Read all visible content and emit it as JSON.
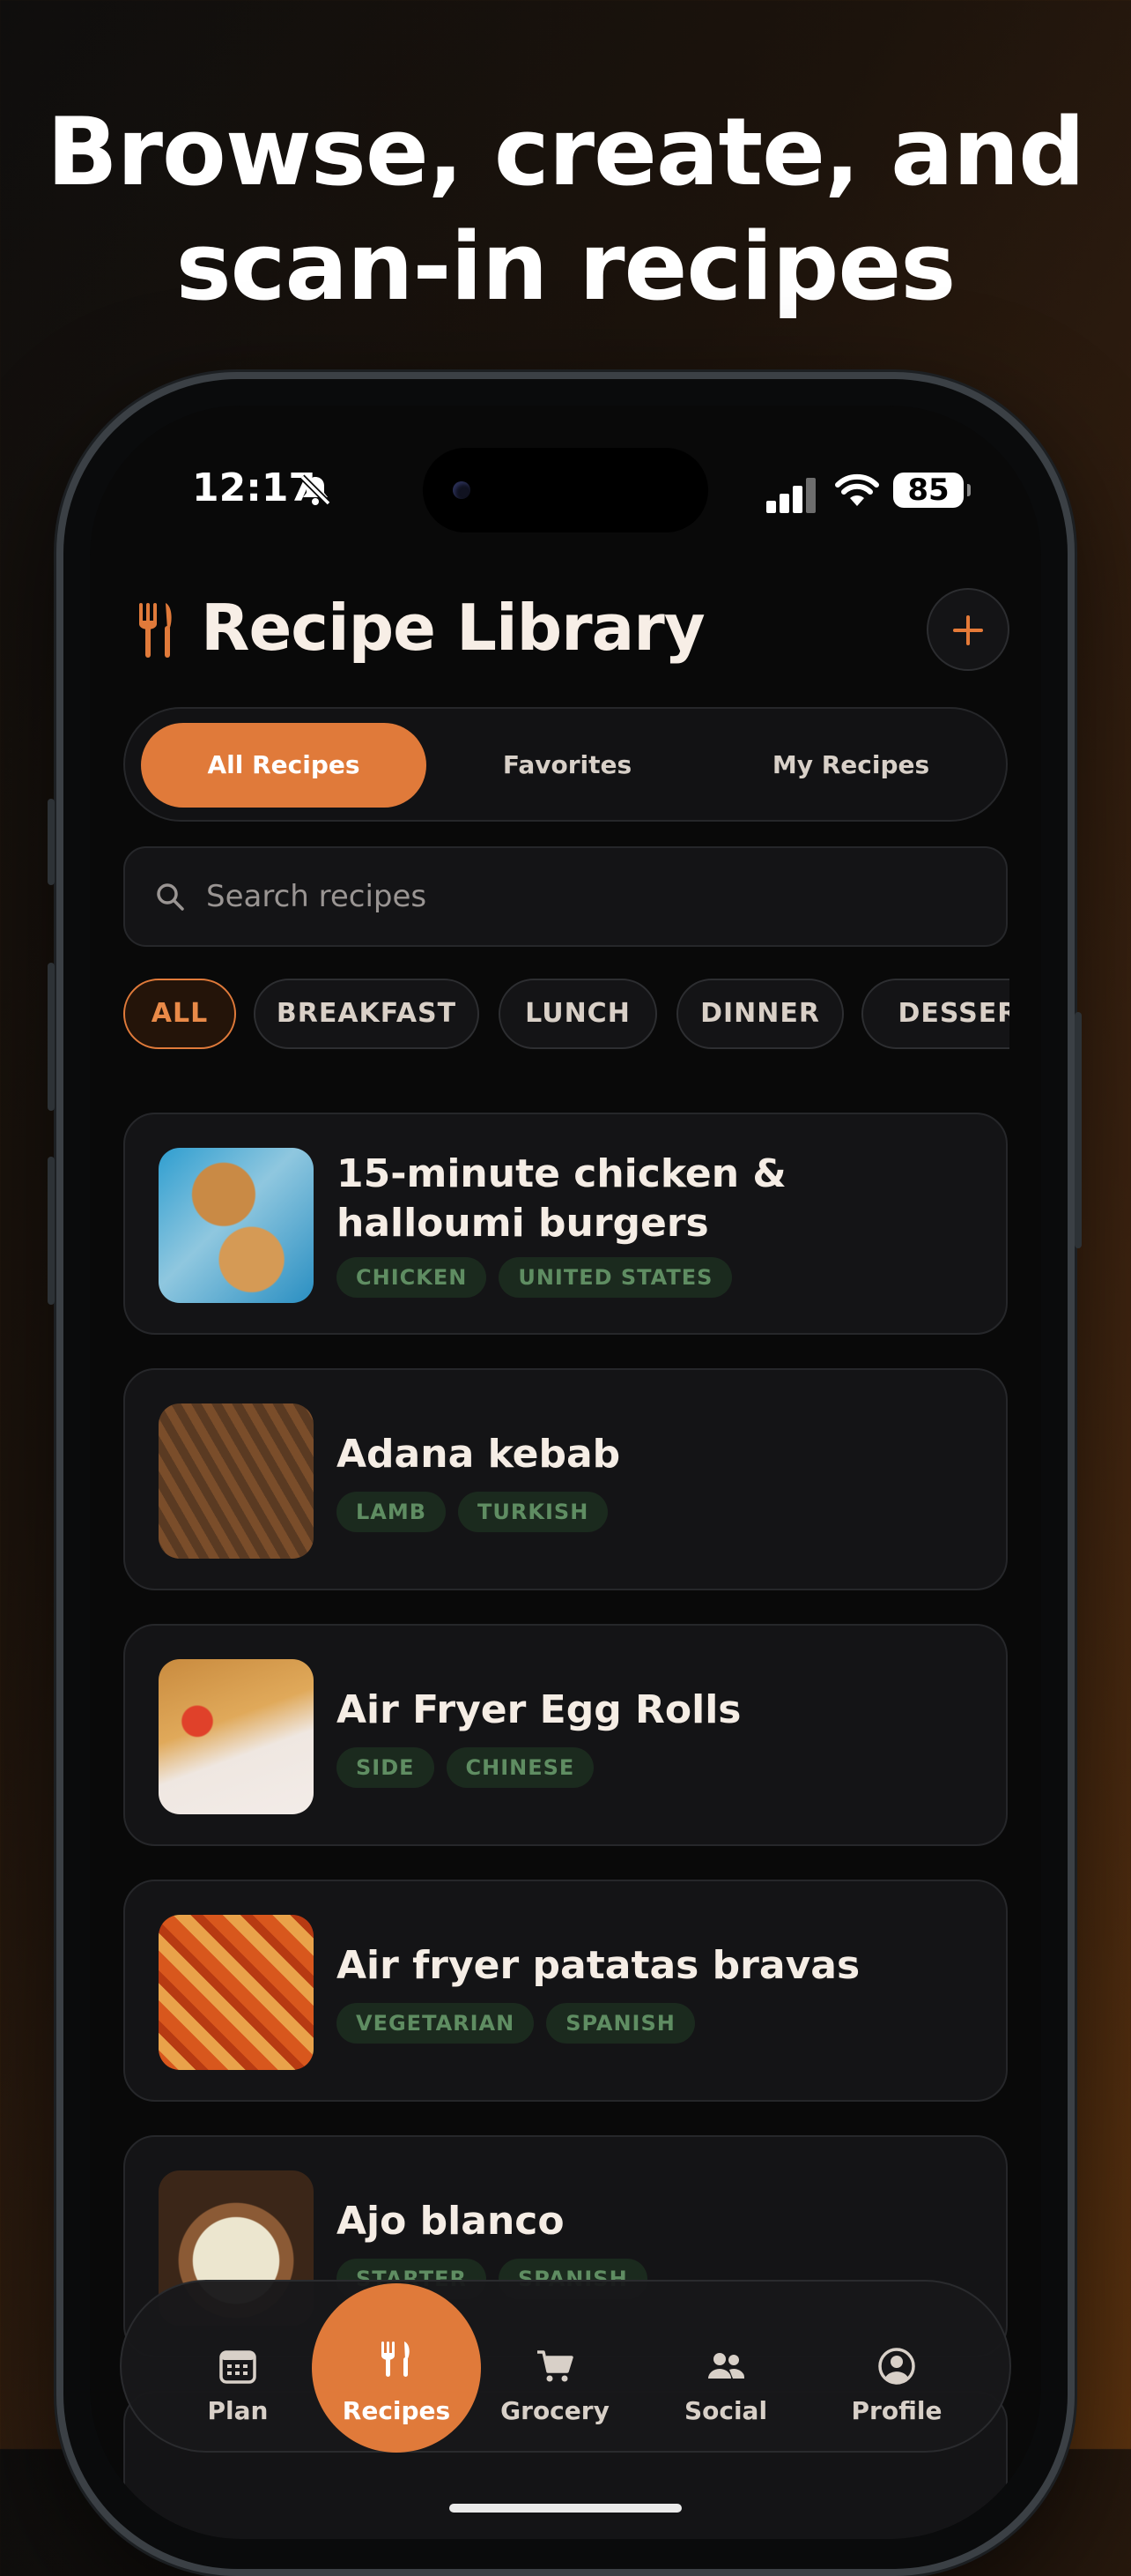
{
  "headline": {
    "line1": "Browse, create, and",
    "line2": "scan-in recipes"
  },
  "status_bar": {
    "time": "12:17",
    "battery": "85"
  },
  "header": {
    "title": "Recipe Library",
    "icon": "fork-knife-icon",
    "add_icon": "plus-icon"
  },
  "segments": [
    {
      "label": "All Recipes",
      "active": true
    },
    {
      "label": "Favorites",
      "active": false
    },
    {
      "label": "My Recipes",
      "active": false
    }
  ],
  "search": {
    "placeholder": "Search recipes",
    "value": ""
  },
  "categories": [
    {
      "label": "ALL",
      "active": true
    },
    {
      "label": "BREAKFAST",
      "active": false
    },
    {
      "label": "LUNCH",
      "active": false
    },
    {
      "label": "DINNER",
      "active": false
    },
    {
      "label": "DESSERT",
      "active": false
    }
  ],
  "recipes": [
    {
      "title": "15-minute chicken & halloumi burgers",
      "tags": [
        "CHICKEN",
        "UNITED STATES"
      ]
    },
    {
      "title": "Adana kebab",
      "tags": [
        "LAMB",
        "TURKISH"
      ]
    },
    {
      "title": "Air Fryer Egg Rolls",
      "tags": [
        "SIDE",
        "CHINESE"
      ]
    },
    {
      "title": "Air fryer patatas bravas",
      "tags": [
        "VEGETARIAN",
        "SPANISH"
      ]
    },
    {
      "title": "Ajo blanco",
      "tags": [
        "STARTER",
        "SPANISH"
      ]
    }
  ],
  "tabbar": [
    {
      "label": "Plan",
      "icon": "calendar-icon",
      "active": false
    },
    {
      "label": "Recipes",
      "icon": "fork-knife-icon",
      "active": true
    },
    {
      "label": "Grocery",
      "icon": "cart-icon",
      "active": false
    },
    {
      "label": "Social",
      "icon": "people-icon",
      "active": false
    },
    {
      "label": "Profile",
      "icon": "profile-icon",
      "active": false
    }
  ],
  "colors": {
    "accent": "#e07a3a",
    "tag_bg": "#1b2a1e",
    "tag_text": "#5f8d62",
    "card_bg": "#141416"
  }
}
